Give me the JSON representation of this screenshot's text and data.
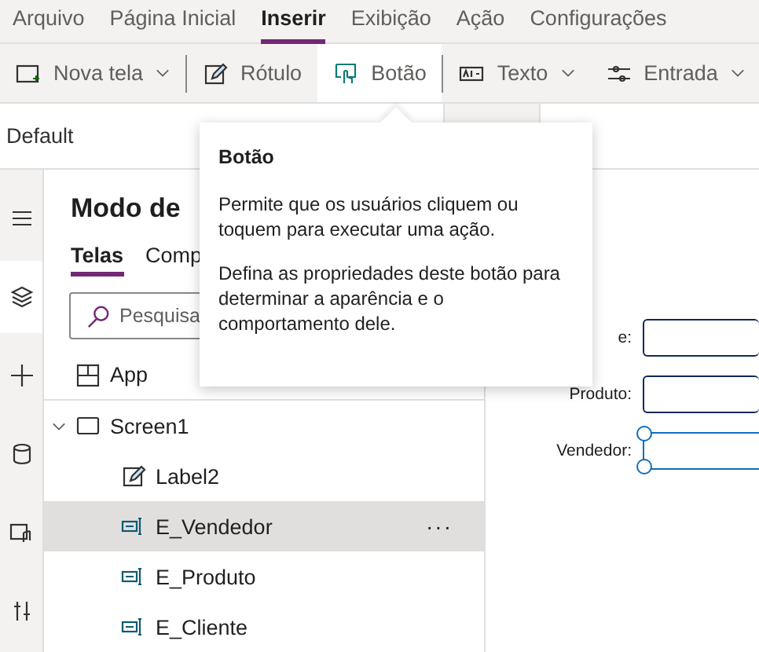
{
  "menu": [
    {
      "label": "Arquivo",
      "selected": false
    },
    {
      "label": "Página Inicial",
      "selected": false
    },
    {
      "label": "Inserir",
      "selected": true
    },
    {
      "label": "Exibição",
      "selected": false
    },
    {
      "label": "Ação",
      "selected": false
    },
    {
      "label": "Configurações",
      "selected": false
    }
  ],
  "toolbar": [
    {
      "label": "Nova tela",
      "kind": "screen",
      "dropdown": true,
      "selected": false,
      "divider_after": true
    },
    {
      "label": "Rótulo",
      "kind": "label",
      "dropdown": false,
      "selected": false,
      "divider_after": false
    },
    {
      "label": "Botão",
      "kind": "button",
      "dropdown": false,
      "selected": true,
      "divider_after": true
    },
    {
      "label": "Texto",
      "kind": "text",
      "dropdown": true,
      "selected": false,
      "divider_after": false
    },
    {
      "label": "Entrada",
      "kind": "input",
      "dropdown": true,
      "selected": false,
      "divider_after": false
    }
  ],
  "formula_bar": {
    "property": "Default"
  },
  "rail": [
    {
      "kind": "menu",
      "selected": false
    },
    {
      "kind": "layers",
      "selected": true
    },
    {
      "kind": "add",
      "selected": false
    },
    {
      "kind": "data",
      "selected": false
    },
    {
      "kind": "media",
      "selected": false
    },
    {
      "kind": "tools",
      "selected": false
    }
  ],
  "panel": {
    "title": "Modo de",
    "tabs": [
      {
        "label": "Telas",
        "selected": true
      },
      {
        "label": "Comp",
        "selected": false
      }
    ],
    "search": {
      "placeholder": "Pesquisa"
    },
    "more": "···",
    "tree": [
      {
        "label": "App",
        "kind": "app",
        "selected": false
      },
      {
        "label": "Screen1",
        "kind": "screen",
        "selected": false,
        "expanded": true,
        "children": [
          {
            "label": "Label2",
            "kind": "label",
            "selected": false
          },
          {
            "label": "E_Vendedor",
            "kind": "input",
            "selected": true
          },
          {
            "label": "E_Produto",
            "kind": "input",
            "selected": false
          },
          {
            "label": "E_Cliente",
            "kind": "input",
            "selected": false
          }
        ]
      }
    ]
  },
  "canvas": {
    "fields": [
      {
        "label": "e:",
        "selected": false
      },
      {
        "label": "Produto:",
        "selected": false
      },
      {
        "label": "Vendedor:",
        "selected": true
      }
    ]
  },
  "tooltip": {
    "title": "Botão",
    "paragraphs": [
      "Permite que os usuários cliquem ou toquem para executar uma ação.",
      "Defina as propriedades deste botão para determinar a aparência e o comportamento dele."
    ]
  }
}
